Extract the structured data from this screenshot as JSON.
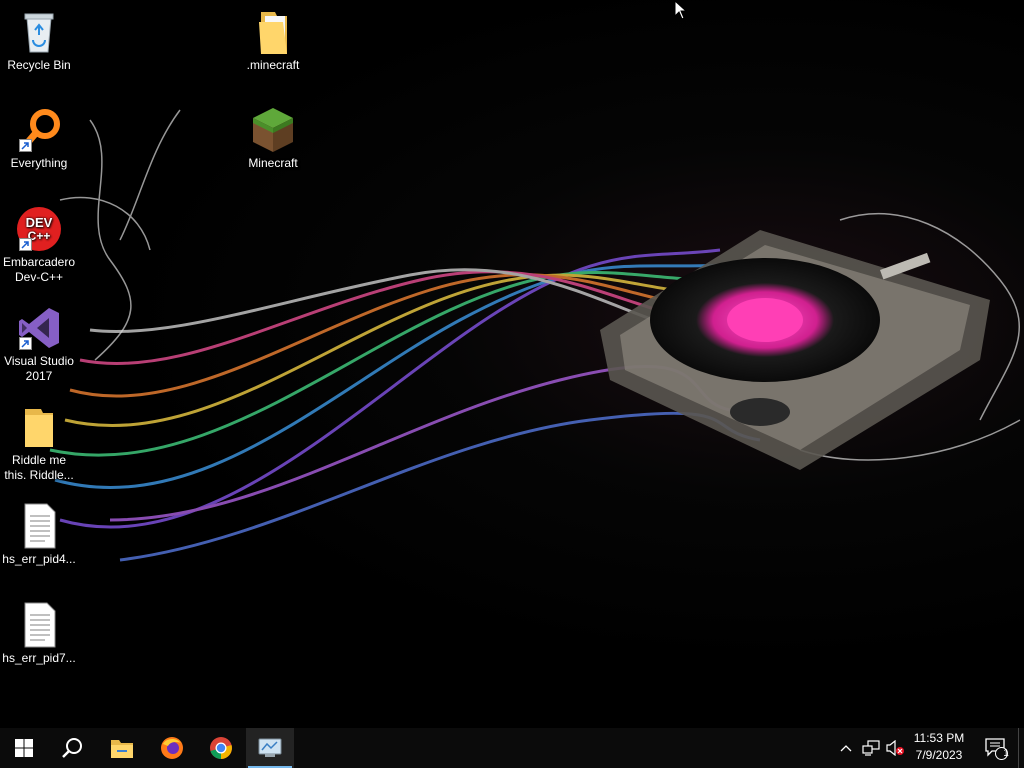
{
  "desktop": {
    "icons_left": [
      {
        "label": "Recycle Bin",
        "icon": "recycle-bin-icon"
      },
      {
        "label": "Everything",
        "icon": "everything-search-icon"
      },
      {
        "label": "Embarcadero Dev-C++",
        "icon": "devcpp-icon",
        "badge": "DEV C++"
      },
      {
        "label": "Visual Studio 2017",
        "icon": "visual-studio-icon"
      },
      {
        "label": "Riddle me this. Riddle...",
        "icon": "folder-icon"
      },
      {
        "label": "hs_err_pid4...",
        "icon": "text-file-icon"
      },
      {
        "label": "hs_err_pid7...",
        "icon": "text-file-icon"
      }
    ],
    "icons_right": [
      {
        "label": ".minecraft",
        "icon": "folder-icon"
      },
      {
        "label": "Minecraft",
        "icon": "minecraft-grass-block-icon"
      }
    ]
  },
  "taskbar": {
    "start": "windows-start-icon",
    "search": "search-icon",
    "pinned": [
      "file-explorer-icon",
      "firefox-icon",
      "chrome-icon",
      "control-panel-app-icon"
    ],
    "tray_icons": [
      "chevron-up-icon",
      "network-icon",
      "volume-muted-icon"
    ],
    "clock_time": "11:53 PM",
    "clock_date": "7/9/2023",
    "notification_count": "1"
  },
  "colors": {
    "taskbar": "#0b0b0b",
    "accent": "#76b9ed",
    "disc": "#ff2fa8"
  }
}
